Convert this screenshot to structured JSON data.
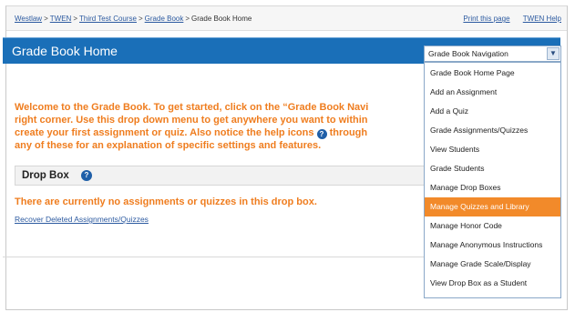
{
  "breadcrumb": {
    "items": [
      "Westlaw",
      "TWEN",
      "Third Test Course",
      "Grade Book"
    ],
    "current": "Grade Book Home",
    "separator": ">"
  },
  "top_links": {
    "print": "Print this page",
    "help": "TWEN Help"
  },
  "header": {
    "title": "Grade Book Home"
  },
  "nav_select": {
    "value": "Grade Book Navigation"
  },
  "nav_menu": {
    "items": [
      "Grade Book Home Page",
      "Add an Assignment",
      "Add a Quiz",
      "Grade Assignments/Quizzes",
      "View Students",
      "Grade Students",
      "Manage Drop Boxes",
      "Manage Quizzes and Library",
      "Manage Honor Code",
      "Manage Anonymous Instructions",
      "Manage Grade Scale/Display",
      "View Drop Box as a Student"
    ],
    "highlighted": "Manage Quizzes and Library"
  },
  "welcome": {
    "line1": "Welcome to the Grade Book. To get started, click on the “Grade Book Navi",
    "line2": "right corner. Use this drop down menu to get anywhere you want to within",
    "line3a": "create your first assignment or quiz. Also notice the help icons",
    "line3b": "through",
    "line4": "any of these for an explanation of specific settings and features."
  },
  "drop_box": {
    "title": "Drop Box",
    "help_glyph": "?"
  },
  "empty_message": "There are currently no assignments or quizzes in this drop box.",
  "recover_link": "Recover Deleted Assignments/Quizzes",
  "colors": {
    "header_blue": "#1a6fb8",
    "accent_orange": "#ef7d1f",
    "highlight_orange": "#f28a2a",
    "link_blue": "#2c5aa0"
  },
  "icons": {
    "help": "help-icon",
    "dropdown": "chevron-down-icon"
  }
}
